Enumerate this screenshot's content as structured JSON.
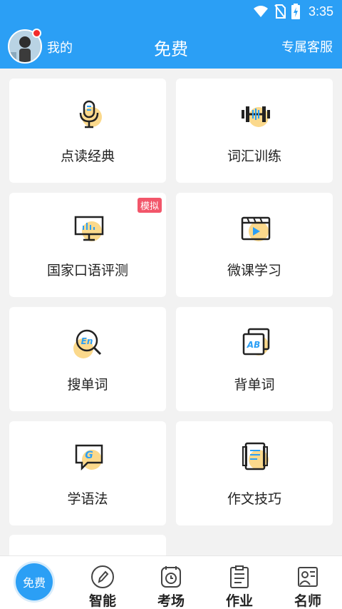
{
  "status_bar": {
    "time": "3:35"
  },
  "header": {
    "mine_label": "我的",
    "title": "免费",
    "service_label": "专属客服"
  },
  "features": [
    {
      "label": "点读经典",
      "icon": "microphone-icon"
    },
    {
      "label": "词汇训练",
      "icon": "dumbbell-icon"
    },
    {
      "label": "国家口语评测",
      "icon": "presentation-board-icon",
      "badge": "模拟"
    },
    {
      "label": "微课学习",
      "icon": "video-play-icon"
    },
    {
      "label": "搜单词",
      "icon": "search-en-icon"
    },
    {
      "label": "背单词",
      "icon": "ab-cards-icon"
    },
    {
      "label": "学语法",
      "icon": "grammar-g-icon"
    },
    {
      "label": "作文技巧",
      "icon": "document-icon"
    }
  ],
  "tabbar": {
    "tabs": [
      {
        "label": "免费",
        "icon": "free-circle-icon",
        "active": true
      },
      {
        "label": "智能",
        "icon": "pen-circle-icon"
      },
      {
        "label": "考场",
        "icon": "clock-icon"
      },
      {
        "label": "作业",
        "icon": "clipboard-icon"
      },
      {
        "label": "名师",
        "icon": "teacher-icon"
      }
    ]
  },
  "colors": {
    "primary": "#2b9ff5",
    "accent_blob": "#fbd98c",
    "badge": "#f2566a",
    "notify_dot": "#f22b2b"
  }
}
